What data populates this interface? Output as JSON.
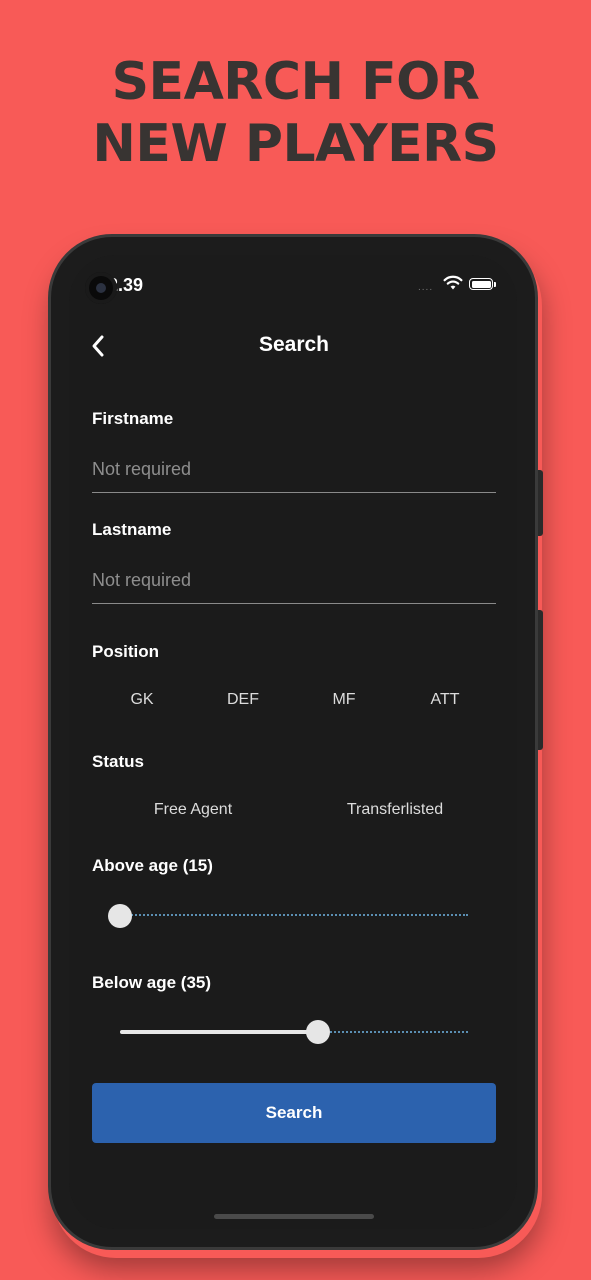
{
  "headline": {
    "line1": "SEARCH FOR",
    "line2": "NEW PLAYERS"
  },
  "status_bar": {
    "time": "2.39",
    "signal": "....",
    "icons": [
      "wifi-icon",
      "battery-icon"
    ]
  },
  "nav": {
    "back_icon": "chevron-left-icon",
    "title": "Search"
  },
  "form": {
    "firstname": {
      "label": "Firstname",
      "placeholder": "Not required",
      "value": ""
    },
    "lastname": {
      "label": "Lastname",
      "placeholder": "Not required",
      "value": ""
    },
    "position": {
      "label": "Position",
      "options": [
        "GK",
        "DEF",
        "MF",
        "ATT"
      ]
    },
    "status": {
      "label": "Status",
      "options": [
        "Free Agent",
        "Transferlisted"
      ]
    },
    "above_age": {
      "label": "Above age (15)",
      "value": 0
    },
    "below_age": {
      "label": "Below age (35)",
      "value": 0.57
    },
    "submit_label": "Search"
  },
  "colors": {
    "background": "#f85a57",
    "headline": "#383432",
    "screen": "#1b1b1b",
    "button": "#2c62ae",
    "slider_dots": "#5b8fb3"
  }
}
